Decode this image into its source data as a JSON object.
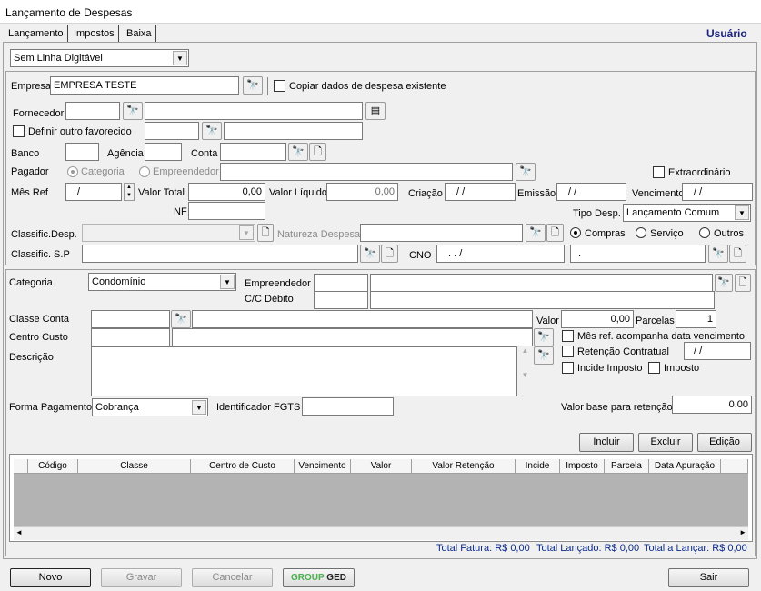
{
  "window": {
    "title": "Lançamento de Despesas",
    "user_label": "Usuário"
  },
  "tabs": [
    "Lançamento",
    "Impostos",
    "Baixa"
  ],
  "linha_digitavel": {
    "value": "Sem Linha Digitável"
  },
  "empresa": {
    "label": "Empresa",
    "value": "EMPRESA TESTE",
    "copiar_label": "Copiar dados de despesa existente"
  },
  "fornecedor": {
    "label": "Fornecedor",
    "definir_label": "Definir outro favorecido"
  },
  "banco": {
    "label": "Banco",
    "agencia_label": "Agência",
    "conta_label": "Conta"
  },
  "pagador": {
    "label": "Pagador",
    "opt_categoria": "Categoria",
    "opt_empreendedor": "Empreendedor",
    "extraordinario_label": "Extraordinário"
  },
  "valores": {
    "mesref_label": "Mês Ref",
    "mesref_value": "/",
    "total_label": "Valor Total",
    "total_value": "0,00",
    "liquido_label": "Valor Líquido",
    "liquido_value": "0,00",
    "criacao_label": "Criação",
    "criacao_value": "/ /",
    "emissao_label": "Emissão",
    "emissao_value": "/ /",
    "vencimento_label": "Vencimento",
    "vencimento_value": "/ /",
    "nf_label": "NF"
  },
  "tipo_desp": {
    "label": "Tipo Desp.",
    "value": "Lançamento Comum"
  },
  "classific": {
    "desp_label": "Classific.Desp.",
    "natureza_label": "Natureza Despesa",
    "opt_compras": "Compras",
    "opt_servico": "Serviço",
    "opt_outros": "Outros",
    "sp_label": "Classific. S.P",
    "cno_label": "CNO",
    "cno_value": ".  .    /",
    "cno2_value": "."
  },
  "item": {
    "categoria_label": "Categoria",
    "categoria_value": "Condomínio",
    "empreendedor_label": "Empreendedor",
    "ccdebito_label": "C/C Débito",
    "classe_label": "Classe Conta",
    "valor_label": "Valor",
    "valor_value": "0,00",
    "parcelas_label": "Parcelas",
    "parcelas_value": "1",
    "centro_label": "Centro Custo",
    "mesref_chk_label": "Mês ref. acompanha data vencimento",
    "retencao_label": "Retenção Contratual",
    "retencao_value": "/ /",
    "descricao_label": "Descrição",
    "incide_label": "Incide Imposto",
    "imposto_label": "Imposto",
    "forma_label": "Forma Pagamento",
    "forma_value": "Cobrança",
    "fgts_label": "Identificador FGTS",
    "base_label": "Valor base para retenção",
    "base_value": "0,00"
  },
  "grid_buttons": {
    "incluir": "Incluir",
    "excluir": "Excluir",
    "edicao": "Edição"
  },
  "grid": {
    "columns": [
      "Código",
      "Classe",
      "Centro de Custo",
      "Vencimento",
      "Valor",
      "Valor Retenção",
      "Incide",
      "Imposto",
      "Parcela",
      "Data Apuração"
    ]
  },
  "totals": {
    "fatura": "Total Fatura: R$ 0,00",
    "lancado": "Total Lançado: R$ 0,00",
    "a_lancar": "Total a Lançar: R$ 0,00"
  },
  "footer": {
    "novo": "Novo",
    "gravar": "Gravar",
    "cancelar": "Cancelar",
    "ged_group": "GROUP",
    "ged_text": "GED",
    "sair": "Sair"
  }
}
